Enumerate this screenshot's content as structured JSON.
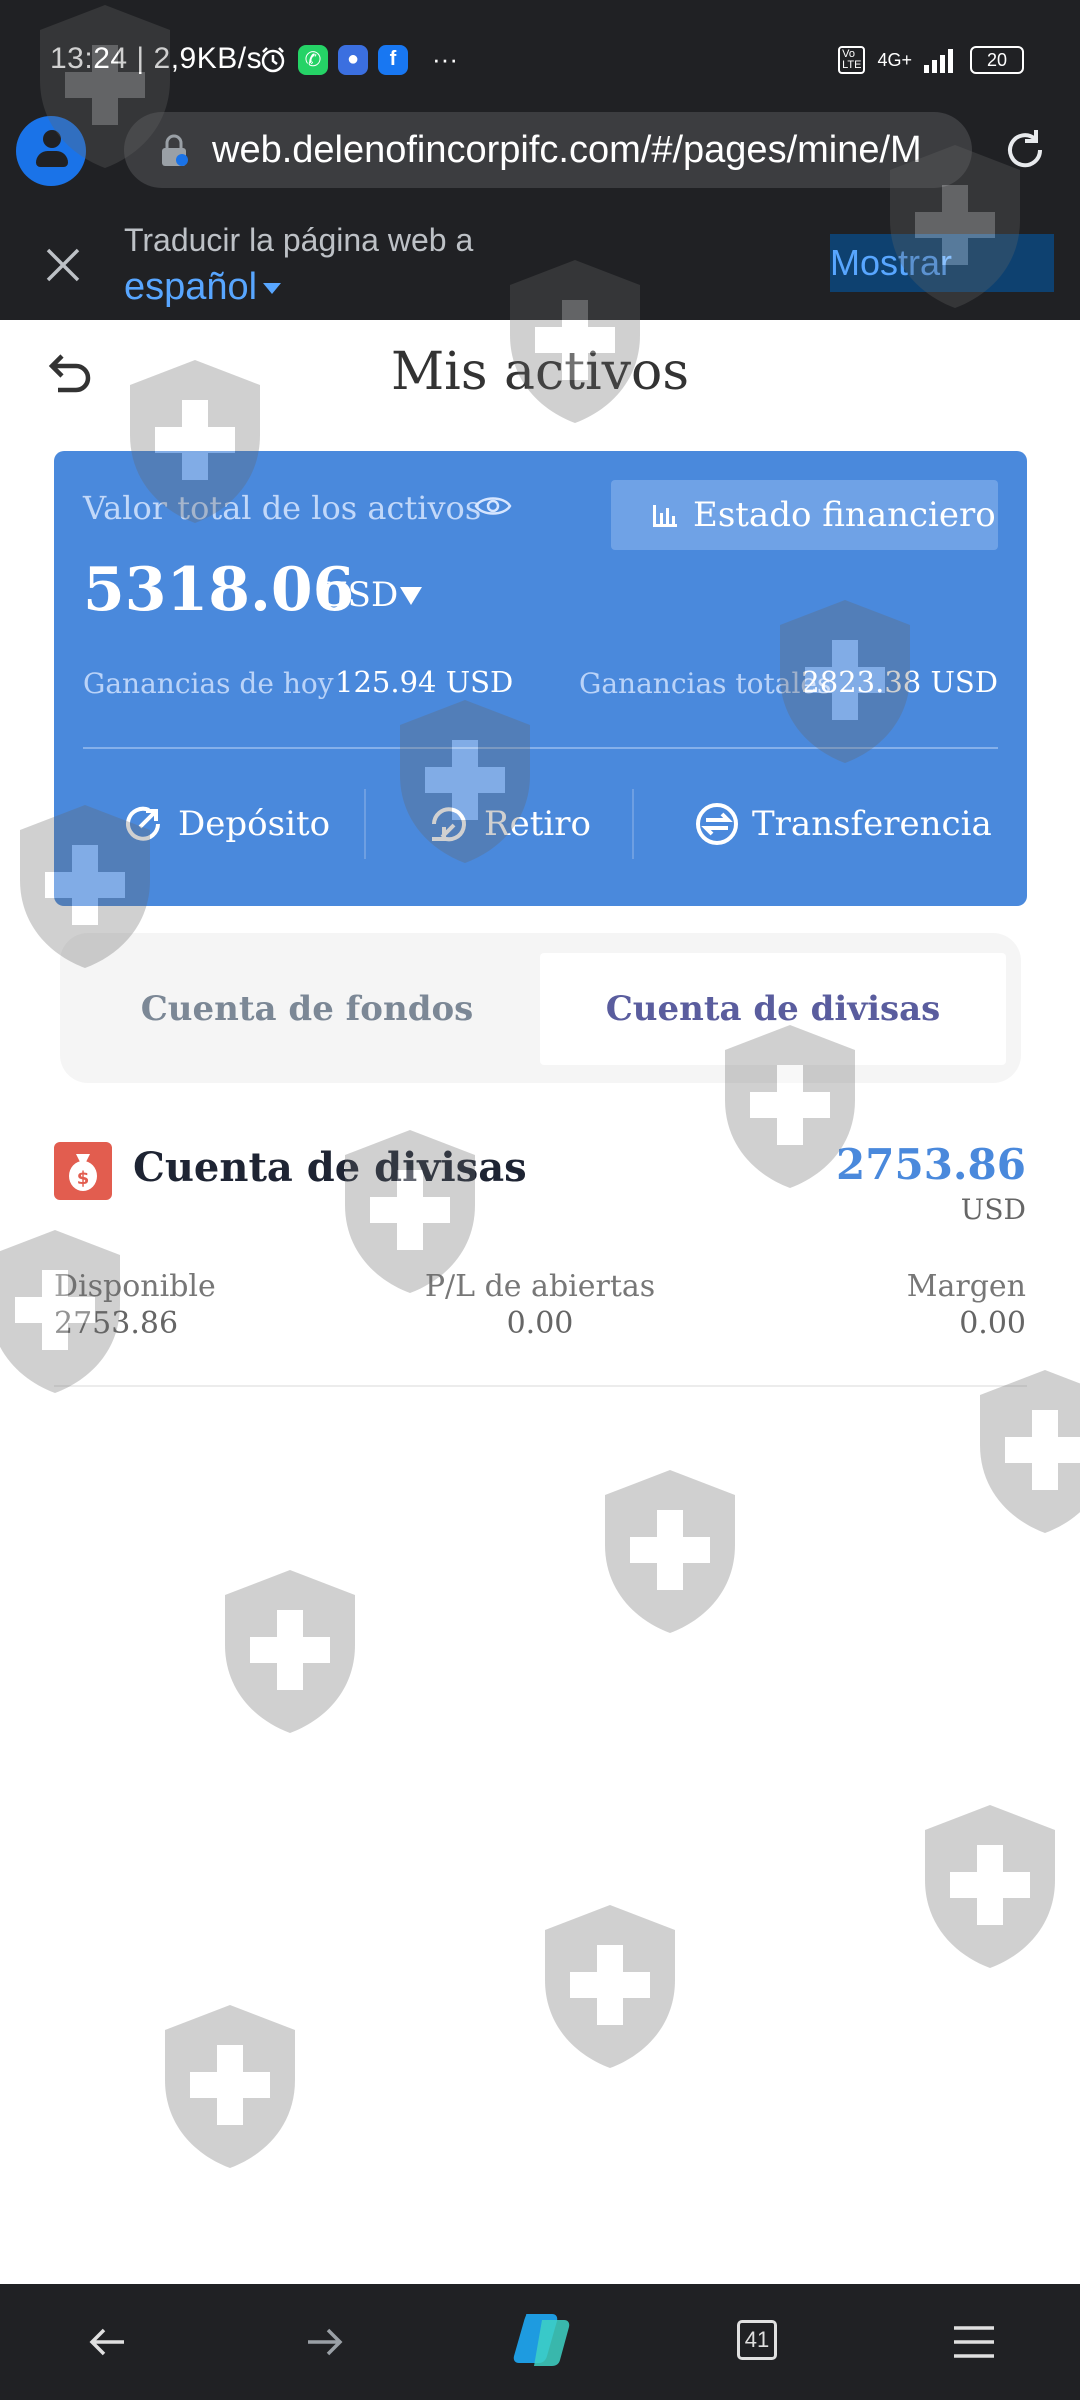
{
  "status_bar": {
    "time_speed": "13:24 | 2,9KB/s",
    "more": "···",
    "network": "4G+",
    "battery": "20"
  },
  "browser": {
    "url": "web.delenofincorpifc.com/#/pages/mine/M",
    "translate_prompt": "Traducir la página web a",
    "translate_language": "español",
    "show_label": "Mostrar",
    "tab_count": "41"
  },
  "page": {
    "title": "Mis activos"
  },
  "asset_card": {
    "total_label": "Valor total de los activos",
    "financial_button": "Estado financiero",
    "total_value": "5318.06",
    "currency": "USD",
    "today_label": "Ganancias de hoy",
    "today_value": "125.94 USD",
    "total_gains_label": "Ganancias totales",
    "total_gains_value": "2823.38 USD",
    "actions": {
      "deposit": "Depósito",
      "withdraw": "Retiro",
      "transfer": "Transferencia"
    }
  },
  "tabs": {
    "funds": "Cuenta de fondos",
    "currency": "Cuenta de divisas"
  },
  "account": {
    "title": "Cuenta de divisas",
    "amount": "2753.86",
    "currency": "USD",
    "available_label": "Disponible",
    "available_value": "2753.86",
    "open_pl_label": "P/L de abiertas",
    "open_pl_value": "0.00",
    "margin_label": "Margen",
    "margin_value": "0.00"
  },
  "colors": {
    "card_blue": "#4a89dc",
    "accent_blue": "#1a73e8",
    "account_icon_red": "#e25d4f",
    "active_tab_text": "#5a5d9e"
  }
}
